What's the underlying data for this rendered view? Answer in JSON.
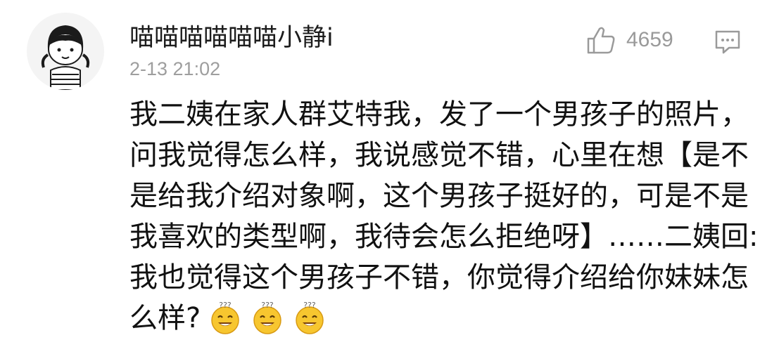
{
  "comment": {
    "username": "喵喵喵喵喵喵小静i",
    "timestamp": "2-13 21:02",
    "likes": {
      "icon": "thumbs-up-icon",
      "count": "4659"
    },
    "reply_icon": "comment-reply-icon",
    "avatar_icon": "cartoon-girl-avatar",
    "lines": [
      "我二姨在家人群艾特我，发了一个男孩子的照片，",
      "问我觉得怎么样，我说感觉不错，心里在想【是不",
      "是给我介绍对象啊，这个男孩子挺好的，可是不是",
      "我喜欢的类型啊，我待会怎么拒绝呀】……二姨回:",
      "我也觉得这个男孩子不错，你觉得介绍给你妹妹怎"
    ],
    "last_line": "么样?",
    "emojis": [
      "dizzy-smile-emoji",
      "dizzy-smile-emoji",
      "dizzy-smile-emoji"
    ],
    "colors": {
      "text": "#111111",
      "meta": "#9e9e9e",
      "emoji_yellow": "#f7c62f"
    }
  }
}
